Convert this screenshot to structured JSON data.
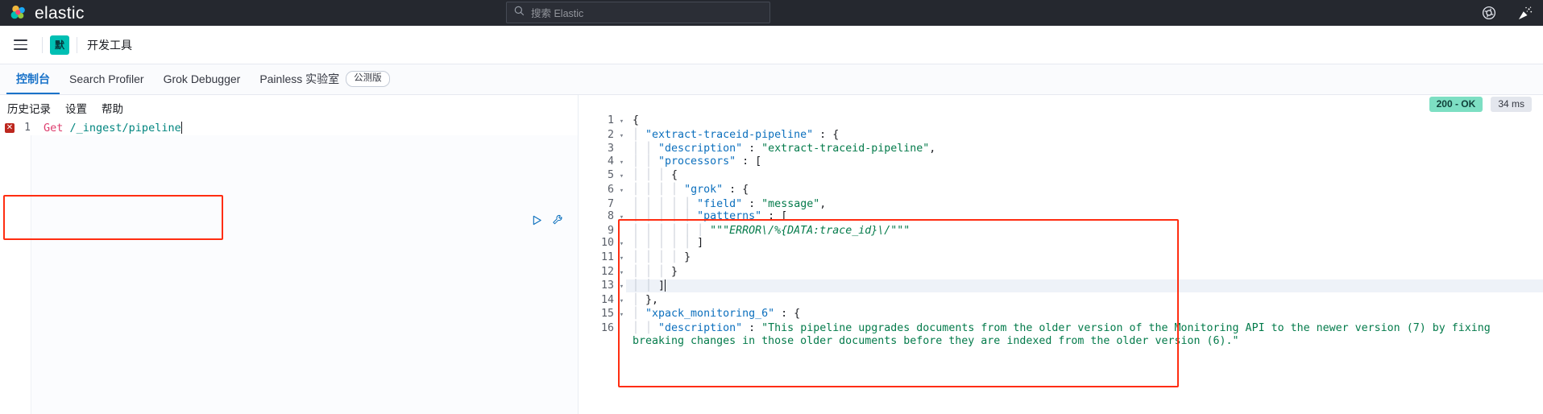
{
  "global_nav": {
    "brand": "elastic",
    "search": {
      "placeholder": "搜索 Elastic",
      "value": ""
    },
    "icons": [
      {
        "name": "help-icon",
        "glyph": "help"
      },
      {
        "name": "whats-new-icon",
        "glyph": "party"
      }
    ]
  },
  "app_header": {
    "menu_icon": "hamburger-icon",
    "space_badge": "默",
    "breadcrumb": "开发工具"
  },
  "tabs": [
    {
      "label": "控制台",
      "active": true,
      "badge": null
    },
    {
      "label": "Search Profiler",
      "active": false,
      "badge": null
    },
    {
      "label": "Grok Debugger",
      "active": false,
      "badge": null
    },
    {
      "label": "Painless 实验室",
      "active": false,
      "badge": "公测版"
    }
  ],
  "console": {
    "menu": [
      {
        "label": "历史记录"
      },
      {
        "label": "设置"
      },
      {
        "label": "帮助"
      }
    ],
    "request": {
      "line_number": "1",
      "error_marker": "✕",
      "method": "Get",
      "url": "/_ingest/pipeline",
      "play_icon": "play-triangle-icon",
      "wrench_icon": "wrench-icon"
    },
    "response": {
      "status": "200 - OK",
      "time": "34 ms",
      "lines": [
        {
          "n": "1",
          "fold": "▾",
          "indent": 0,
          "text": "{"
        },
        {
          "n": "2",
          "fold": "▾",
          "indent": 1,
          "text": "\"extract-traceid-pipeline\" : {"
        },
        {
          "n": "3",
          "fold": "",
          "indent": 2,
          "text": "\"description\" : \"extract-traceid-pipeline\","
        },
        {
          "n": "4",
          "fold": "▾",
          "indent": 2,
          "text": "\"processors\" : ["
        },
        {
          "n": "5",
          "fold": "▾",
          "indent": 3,
          "text": "{"
        },
        {
          "n": "6",
          "fold": "▾",
          "indent": 4,
          "text": "\"grok\" : {"
        },
        {
          "n": "7",
          "fold": "",
          "indent": 5,
          "text": "\"field\" : \"message\","
        },
        {
          "n": "8",
          "fold": "▾",
          "indent": 5,
          "text": "\"patterns\" : ["
        },
        {
          "n": "9",
          "fold": "",
          "indent": 6,
          "text": "\"\"\"ERROR\\/%{DATA:trace_id}\\/\"\"\""
        },
        {
          "n": "10",
          "fold": "▾",
          "indent": 5,
          "text": "]"
        },
        {
          "n": "11",
          "fold": "▾",
          "indent": 4,
          "text": "}"
        },
        {
          "n": "12",
          "fold": "▾",
          "indent": 3,
          "text": "}"
        },
        {
          "n": "13",
          "fold": "▾",
          "indent": 2,
          "text": "]"
        },
        {
          "n": "14",
          "fold": "▾",
          "indent": 1,
          "text": "},"
        },
        {
          "n": "15",
          "fold": "▾",
          "indent": 1,
          "text": "\"xpack_monitoring_6\" : {"
        },
        {
          "n": "16",
          "fold": "",
          "indent": 2,
          "text": "\"description\" : \"This pipeline upgrades documents from the older version of the Monitoring API to the newer version (7) by fixing breaking changes in those older documents before they are indexed from the older version (6).\""
        }
      ]
    }
  },
  "colors": {
    "nav_bg": "#25282f",
    "accent_blue": "#1a73c9",
    "space_teal": "#00bfb3",
    "status_green": "#7ddfc3",
    "annotation_red": "#ff2d11",
    "string_green": "#047b4b",
    "key_blue": "#0b6fbd",
    "method_pink": "#dd3c6d",
    "url_teal": "#00857f"
  }
}
